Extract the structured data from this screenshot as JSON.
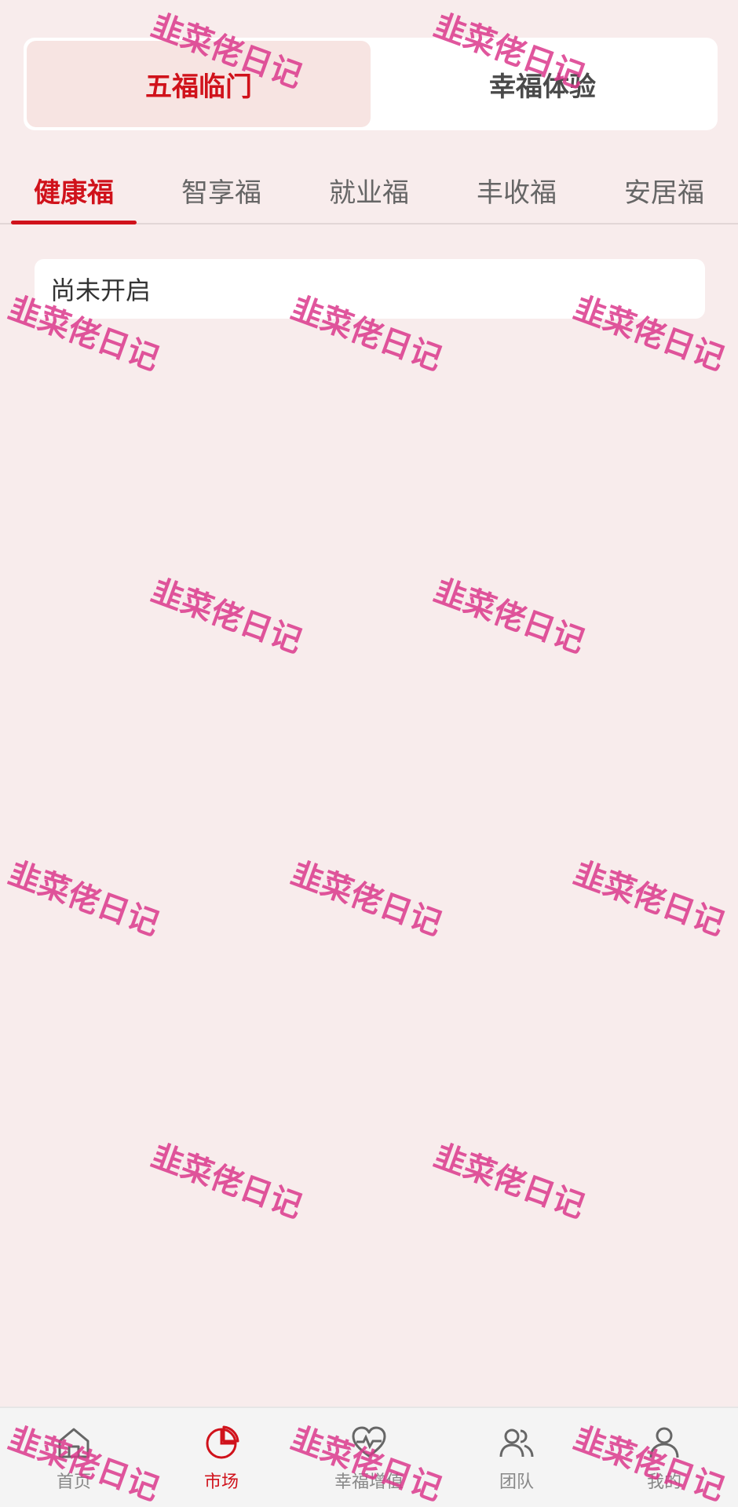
{
  "segments": [
    {
      "label": "五福临门",
      "active": true
    },
    {
      "label": "幸福体验",
      "active": false
    }
  ],
  "tabs": [
    {
      "label": "健康福",
      "active": true
    },
    {
      "label": "智享福",
      "active": false
    },
    {
      "label": "就业福",
      "active": false
    },
    {
      "label": "丰收福",
      "active": false
    },
    {
      "label": "安居福",
      "active": false
    }
  ],
  "status": {
    "text": "尚未开启"
  },
  "watermark_text": "韭菜佬日记",
  "bottom_nav": [
    {
      "label": "首页",
      "icon": "home-icon",
      "active": false
    },
    {
      "label": "市场",
      "icon": "pie-chart-icon",
      "active": true
    },
    {
      "label": "幸福增值",
      "icon": "heart-chart-icon",
      "active": false
    },
    {
      "label": "团队",
      "icon": "team-icon",
      "active": false
    },
    {
      "label": "我的",
      "icon": "user-icon",
      "active": false
    }
  ],
  "colors": {
    "accent": "#d0121b",
    "background": "#f8ecec",
    "watermark": "#db388c"
  }
}
